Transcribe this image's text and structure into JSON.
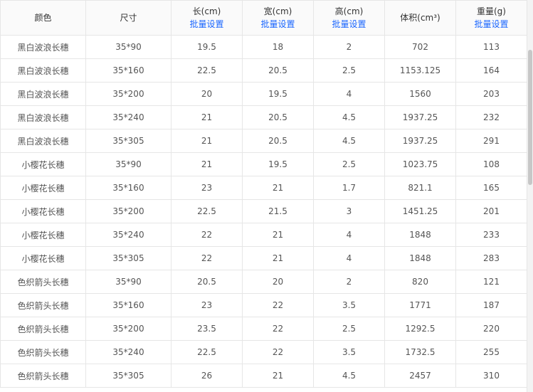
{
  "header": {
    "color": "颜色",
    "size": "尺寸",
    "length": "长(cm)",
    "width": "宽(cm)",
    "height": "高(cm)",
    "volume": "体积(cm³)",
    "weight": "重量(g)",
    "batch_label": "批量设置"
  },
  "rows": [
    {
      "color": "黑白波浪长穗",
      "size": "35*90",
      "length": "19.5",
      "width": "18",
      "height": "2",
      "volume": "702",
      "weight": "113"
    },
    {
      "color": "黑白波浪长穗",
      "size": "35*160",
      "length": "22.5",
      "width": "20.5",
      "height": "2.5",
      "volume": "1153.125",
      "weight": "164"
    },
    {
      "color": "黑白波浪长穗",
      "size": "35*200",
      "length": "20",
      "width": "19.5",
      "height": "4",
      "volume": "1560",
      "weight": "203"
    },
    {
      "color": "黑白波浪长穗",
      "size": "35*240",
      "length": "21",
      "width": "20.5",
      "height": "4.5",
      "volume": "1937.25",
      "weight": "232"
    },
    {
      "color": "黑白波浪长穗",
      "size": "35*305",
      "length": "21",
      "width": "20.5",
      "height": "4.5",
      "volume": "1937.25",
      "weight": "291"
    },
    {
      "color": "小樱花长穗",
      "size": "35*90",
      "length": "21",
      "width": "19.5",
      "height": "2.5",
      "volume": "1023.75",
      "weight": "108"
    },
    {
      "color": "小樱花长穗",
      "size": "35*160",
      "length": "23",
      "width": "21",
      "height": "1.7",
      "volume": "821.1",
      "weight": "165"
    },
    {
      "color": "小樱花长穗",
      "size": "35*200",
      "length": "22.5",
      "width": "21.5",
      "height": "3",
      "volume": "1451.25",
      "weight": "201"
    },
    {
      "color": "小樱花长穗",
      "size": "35*240",
      "length": "22",
      "width": "21",
      "height": "4",
      "volume": "1848",
      "weight": "233"
    },
    {
      "color": "小樱花长穗",
      "size": "35*305",
      "length": "22",
      "width": "21",
      "height": "4",
      "volume": "1848",
      "weight": "283"
    },
    {
      "color": "色织箭头长穗",
      "size": "35*90",
      "length": "20.5",
      "width": "20",
      "height": "2",
      "volume": "820",
      "weight": "121"
    },
    {
      "color": "色织箭头长穗",
      "size": "35*160",
      "length": "23",
      "width": "22",
      "height": "3.5",
      "volume": "1771",
      "weight": "187"
    },
    {
      "color": "色织箭头长穗",
      "size": "35*200",
      "length": "23.5",
      "width": "22",
      "height": "2.5",
      "volume": "1292.5",
      "weight": "220"
    },
    {
      "color": "色织箭头长穗",
      "size": "35*240",
      "length": "22.5",
      "width": "22",
      "height": "3.5",
      "volume": "1732.5",
      "weight": "255"
    },
    {
      "color": "色织箭头长穗",
      "size": "35*305",
      "length": "26",
      "width": "21",
      "height": "4.5",
      "volume": "2457",
      "weight": "310"
    }
  ]
}
